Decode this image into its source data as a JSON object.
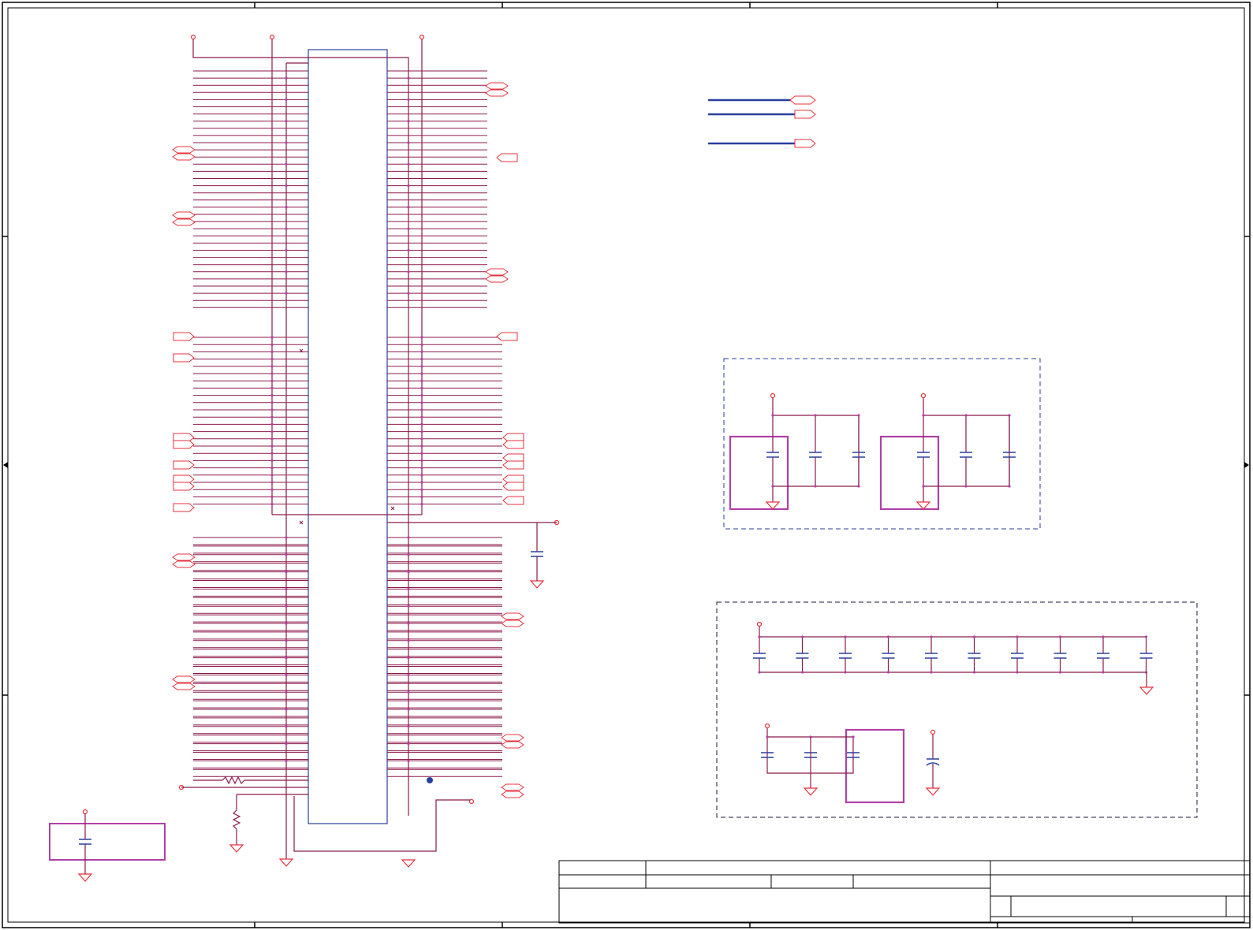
{
  "sheet": {
    "frame_color": "#000000",
    "wire_color": "#8b1a4a",
    "bus_color": "#2a3f9e",
    "port_color": "#e8323c",
    "part_color": "#2a3f9e",
    "highlight_color": "#b040a8",
    "junction_color": "#b040a8"
  },
  "left_bank": {
    "data_lines": 34
  },
  "lower_bank": {
    "data_lines": 28
  },
  "title_block": {
    "rows": 4
  },
  "decoupling": {
    "group_a_caps": 6,
    "group_b_caps": 10,
    "group_c_caps": 4
  }
}
